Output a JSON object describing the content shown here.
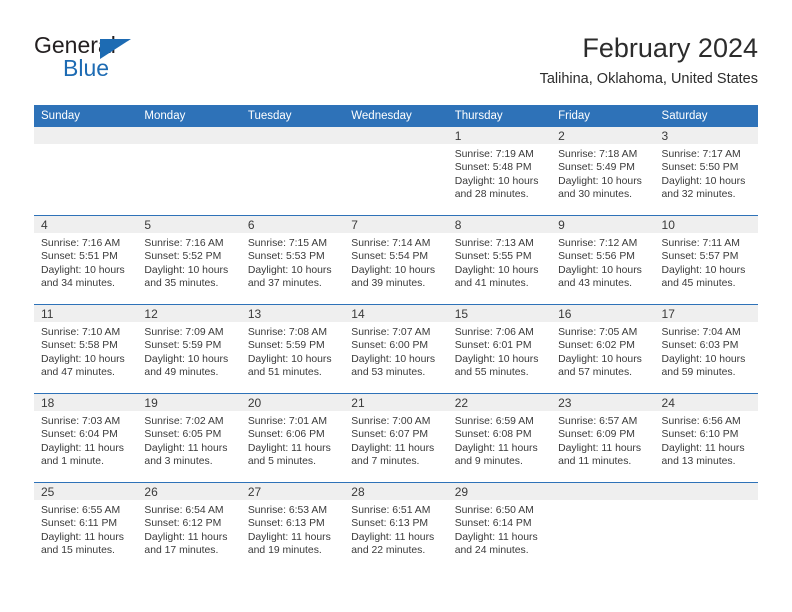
{
  "brand": {
    "name_top": "General",
    "name_bottom": "Blue",
    "triangle_icon": "triangle-icon",
    "color_blue": "#1d6bb3",
    "color_dark": "#231f20"
  },
  "header": {
    "title": "February 2024",
    "subtitle": "Talihina, Oklahoma, United States"
  },
  "theme": {
    "header_band": "#2e72b8",
    "daynum_band": "#efefef",
    "row_separator": "#2e72b8",
    "text": "#3a3a3a"
  },
  "calendar": {
    "columns": [
      "Sunday",
      "Monday",
      "Tuesday",
      "Wednesday",
      "Thursday",
      "Friday",
      "Saturday"
    ],
    "weeks": [
      [
        {
          "day": "",
          "lines": []
        },
        {
          "day": "",
          "lines": []
        },
        {
          "day": "",
          "lines": []
        },
        {
          "day": "",
          "lines": []
        },
        {
          "day": "1",
          "lines": [
            "Sunrise: 7:19 AM",
            "Sunset: 5:48 PM",
            "Daylight: 10 hours",
            "and 28 minutes."
          ]
        },
        {
          "day": "2",
          "lines": [
            "Sunrise: 7:18 AM",
            "Sunset: 5:49 PM",
            "Daylight: 10 hours",
            "and 30 minutes."
          ]
        },
        {
          "day": "3",
          "lines": [
            "Sunrise: 7:17 AM",
            "Sunset: 5:50 PM",
            "Daylight: 10 hours",
            "and 32 minutes."
          ]
        }
      ],
      [
        {
          "day": "4",
          "lines": [
            "Sunrise: 7:16 AM",
            "Sunset: 5:51 PM",
            "Daylight: 10 hours",
            "and 34 minutes."
          ]
        },
        {
          "day": "5",
          "lines": [
            "Sunrise: 7:16 AM",
            "Sunset: 5:52 PM",
            "Daylight: 10 hours",
            "and 35 minutes."
          ]
        },
        {
          "day": "6",
          "lines": [
            "Sunrise: 7:15 AM",
            "Sunset: 5:53 PM",
            "Daylight: 10 hours",
            "and 37 minutes."
          ]
        },
        {
          "day": "7",
          "lines": [
            "Sunrise: 7:14 AM",
            "Sunset: 5:54 PM",
            "Daylight: 10 hours",
            "and 39 minutes."
          ]
        },
        {
          "day": "8",
          "lines": [
            "Sunrise: 7:13 AM",
            "Sunset: 5:55 PM",
            "Daylight: 10 hours",
            "and 41 minutes."
          ]
        },
        {
          "day": "9",
          "lines": [
            "Sunrise: 7:12 AM",
            "Sunset: 5:56 PM",
            "Daylight: 10 hours",
            "and 43 minutes."
          ]
        },
        {
          "day": "10",
          "lines": [
            "Sunrise: 7:11 AM",
            "Sunset: 5:57 PM",
            "Daylight: 10 hours",
            "and 45 minutes."
          ]
        }
      ],
      [
        {
          "day": "11",
          "lines": [
            "Sunrise: 7:10 AM",
            "Sunset: 5:58 PM",
            "Daylight: 10 hours",
            "and 47 minutes."
          ]
        },
        {
          "day": "12",
          "lines": [
            "Sunrise: 7:09 AM",
            "Sunset: 5:59 PM",
            "Daylight: 10 hours",
            "and 49 minutes."
          ]
        },
        {
          "day": "13",
          "lines": [
            "Sunrise: 7:08 AM",
            "Sunset: 5:59 PM",
            "Daylight: 10 hours",
            "and 51 minutes."
          ]
        },
        {
          "day": "14",
          "lines": [
            "Sunrise: 7:07 AM",
            "Sunset: 6:00 PM",
            "Daylight: 10 hours",
            "and 53 minutes."
          ]
        },
        {
          "day": "15",
          "lines": [
            "Sunrise: 7:06 AM",
            "Sunset: 6:01 PM",
            "Daylight: 10 hours",
            "and 55 minutes."
          ]
        },
        {
          "day": "16",
          "lines": [
            "Sunrise: 7:05 AM",
            "Sunset: 6:02 PM",
            "Daylight: 10 hours",
            "and 57 minutes."
          ]
        },
        {
          "day": "17",
          "lines": [
            "Sunrise: 7:04 AM",
            "Sunset: 6:03 PM",
            "Daylight: 10 hours",
            "and 59 minutes."
          ]
        }
      ],
      [
        {
          "day": "18",
          "lines": [
            "Sunrise: 7:03 AM",
            "Sunset: 6:04 PM",
            "Daylight: 11 hours",
            "and 1 minute."
          ]
        },
        {
          "day": "19",
          "lines": [
            "Sunrise: 7:02 AM",
            "Sunset: 6:05 PM",
            "Daylight: 11 hours",
            "and 3 minutes."
          ]
        },
        {
          "day": "20",
          "lines": [
            "Sunrise: 7:01 AM",
            "Sunset: 6:06 PM",
            "Daylight: 11 hours",
            "and 5 minutes."
          ]
        },
        {
          "day": "21",
          "lines": [
            "Sunrise: 7:00 AM",
            "Sunset: 6:07 PM",
            "Daylight: 11 hours",
            "and 7 minutes."
          ]
        },
        {
          "day": "22",
          "lines": [
            "Sunrise: 6:59 AM",
            "Sunset: 6:08 PM",
            "Daylight: 11 hours",
            "and 9 minutes."
          ]
        },
        {
          "day": "23",
          "lines": [
            "Sunrise: 6:57 AM",
            "Sunset: 6:09 PM",
            "Daylight: 11 hours",
            "and 11 minutes."
          ]
        },
        {
          "day": "24",
          "lines": [
            "Sunrise: 6:56 AM",
            "Sunset: 6:10 PM",
            "Daylight: 11 hours",
            "and 13 minutes."
          ]
        }
      ],
      [
        {
          "day": "25",
          "lines": [
            "Sunrise: 6:55 AM",
            "Sunset: 6:11 PM",
            "Daylight: 11 hours",
            "and 15 minutes."
          ]
        },
        {
          "day": "26",
          "lines": [
            "Sunrise: 6:54 AM",
            "Sunset: 6:12 PM",
            "Daylight: 11 hours",
            "and 17 minutes."
          ]
        },
        {
          "day": "27",
          "lines": [
            "Sunrise: 6:53 AM",
            "Sunset: 6:13 PM",
            "Daylight: 11 hours",
            "and 19 minutes."
          ]
        },
        {
          "day": "28",
          "lines": [
            "Sunrise: 6:51 AM",
            "Sunset: 6:13 PM",
            "Daylight: 11 hours",
            "and 22 minutes."
          ]
        },
        {
          "day": "29",
          "lines": [
            "Sunrise: 6:50 AM",
            "Sunset: 6:14 PM",
            "Daylight: 11 hours",
            "and 24 minutes."
          ]
        },
        {
          "day": "",
          "lines": []
        },
        {
          "day": "",
          "lines": []
        }
      ]
    ]
  }
}
